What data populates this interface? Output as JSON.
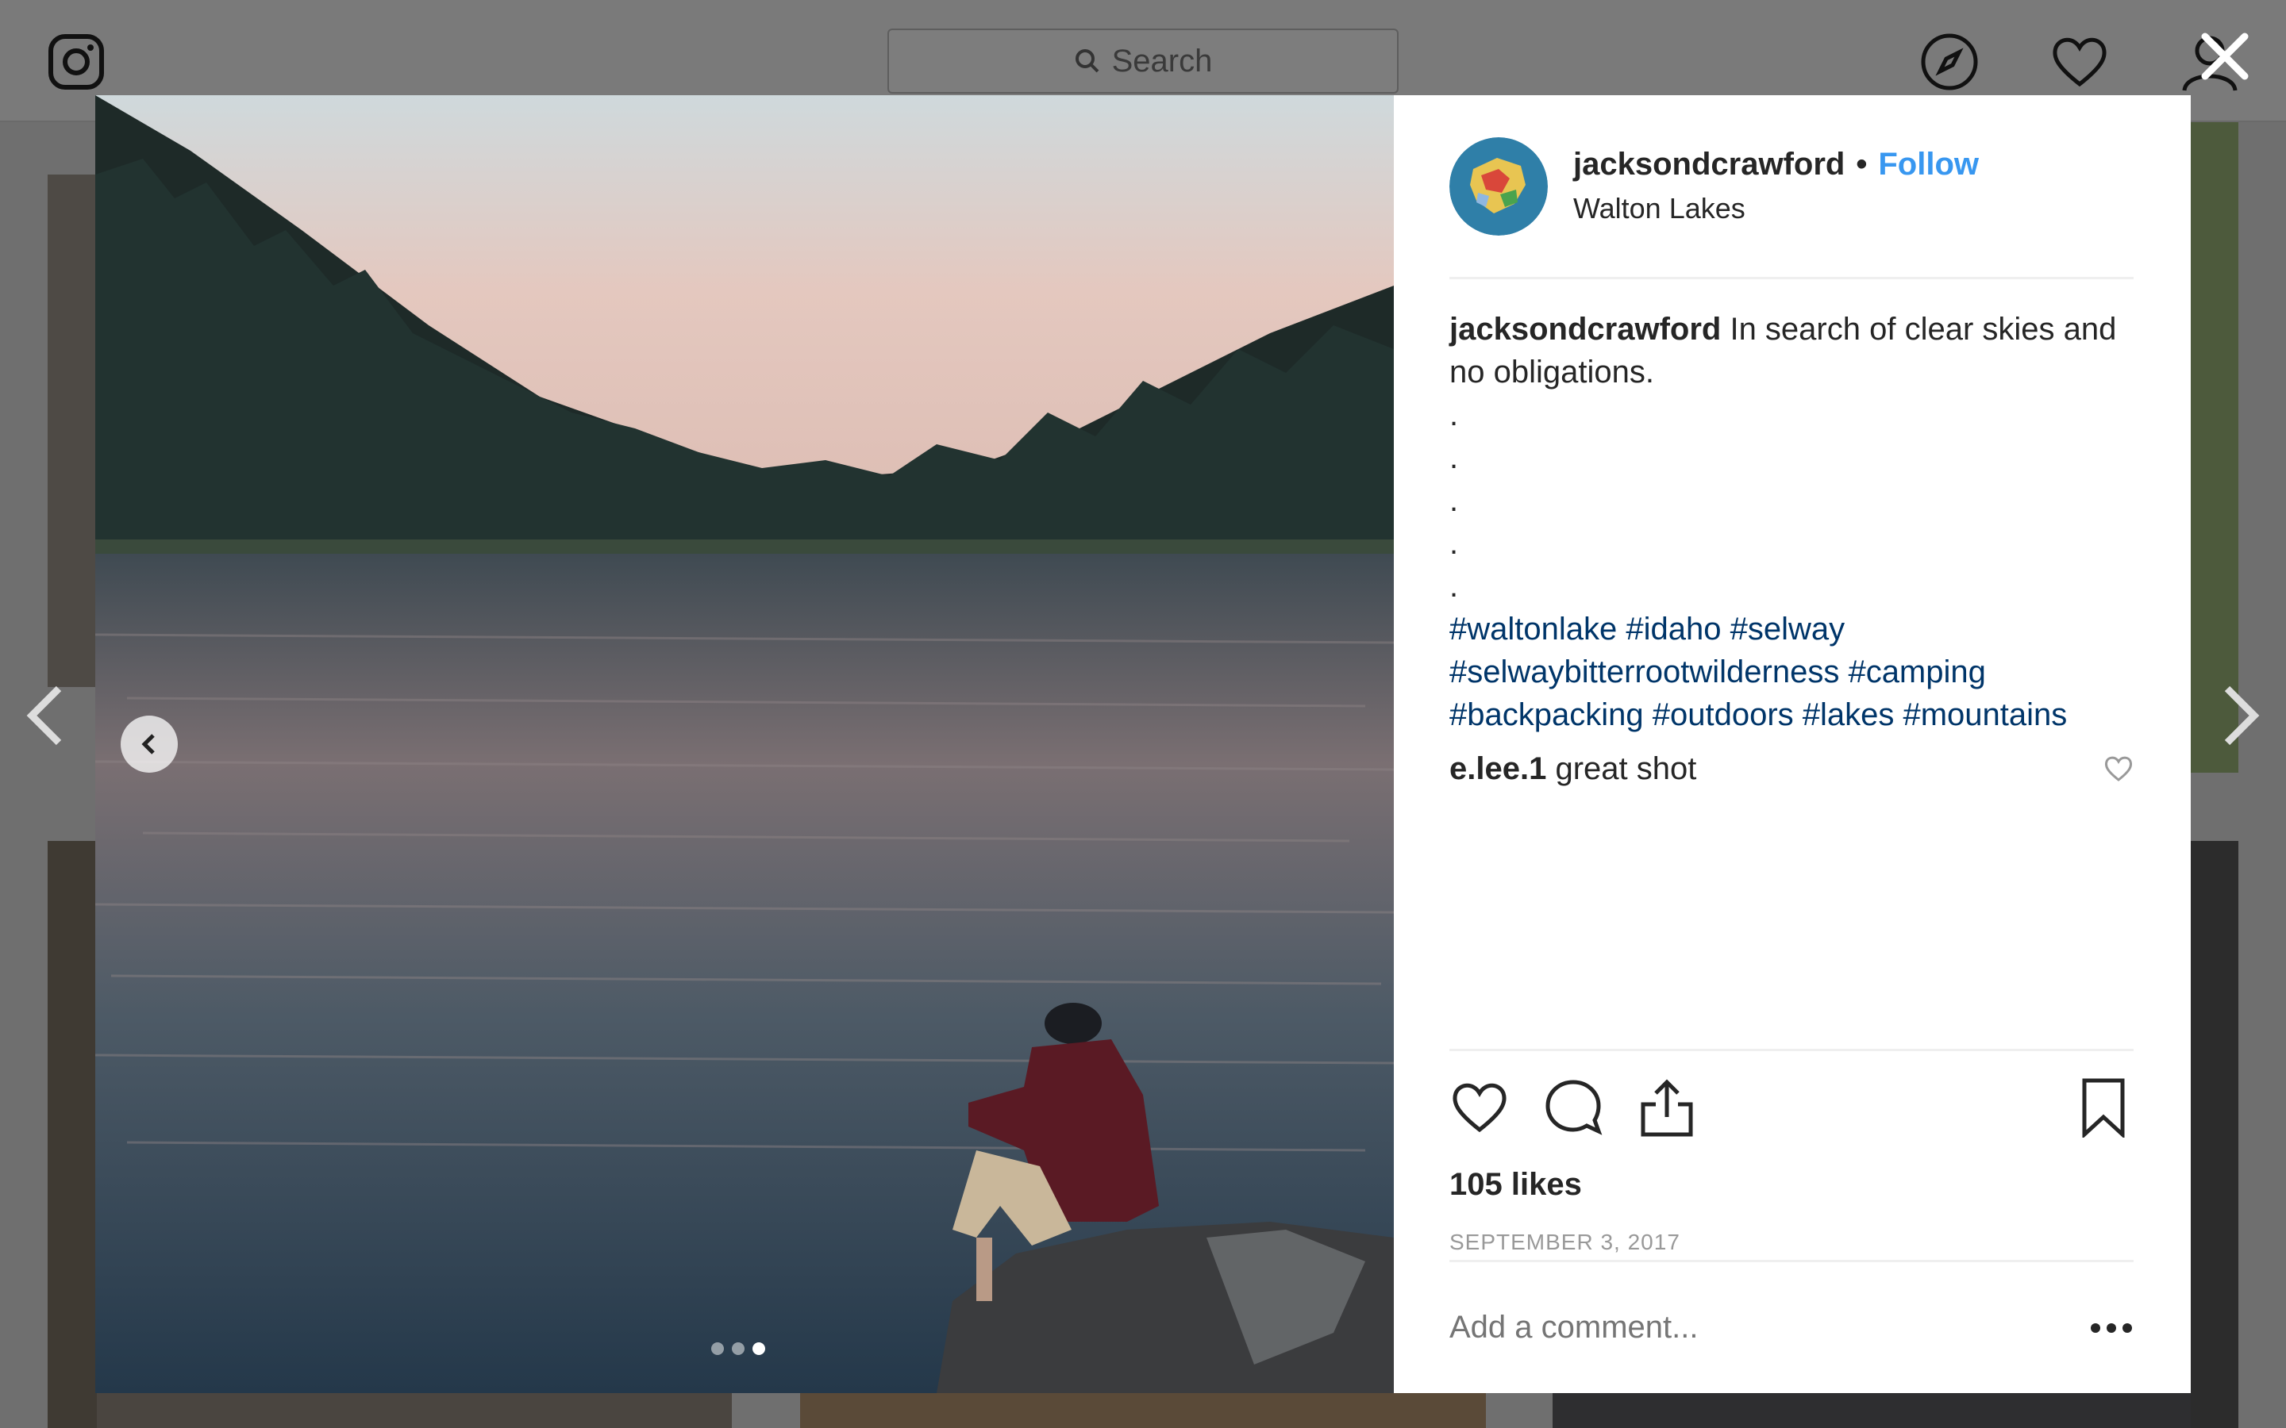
{
  "search": {
    "placeholder": "Search",
    "icon": "search-icon"
  },
  "nav": {
    "icons": [
      "instagram-logo-icon",
      "explore-compass-icon",
      "activity-heart-icon",
      "profile-icon",
      "close-icon"
    ]
  },
  "post": {
    "username": "jacksondcrawford",
    "follow_label": "Follow",
    "location": "Walton Lakes",
    "caption_user": "jacksondcrawford",
    "caption_text": "In search of clear skies and no obligations.",
    "caption_dots": [
      ".",
      ".",
      ".",
      ".",
      "."
    ],
    "hashtags_line1": "#waltonlake #idaho #selway",
    "hashtags_line2": "#selwaybitterrootwilderness #camping",
    "hashtags_line3": "#backpacking #outdoors #lakes #mountains",
    "comment_user": "e.lee.1",
    "comment_text": "great shot",
    "likes": "105 likes",
    "date": "SEPTEMBER 3, 2017",
    "add_comment_placeholder": "Add a comment...",
    "carousel_total": 3,
    "carousel_active": 3
  },
  "colors": {
    "link": "#3897f0",
    "hashtag": "#003569",
    "text": "#262626",
    "muted": "#999999"
  }
}
